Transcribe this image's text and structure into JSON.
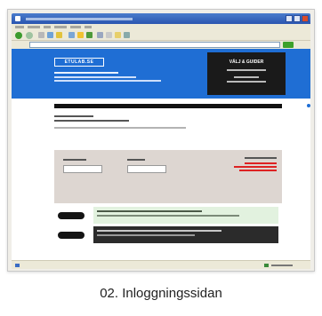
{
  "browser": {
    "window_title": "",
    "menus": [
      "Arkiv",
      "Redigera",
      "Visa",
      "Favoriter",
      "Verktyg",
      "Hjälp"
    ]
  },
  "site": {
    "logo_label": "ETULAB.SE",
    "dark_panel_title": "VÄLJ & GUIDER"
  },
  "caption": "02. Inloggningssidan"
}
